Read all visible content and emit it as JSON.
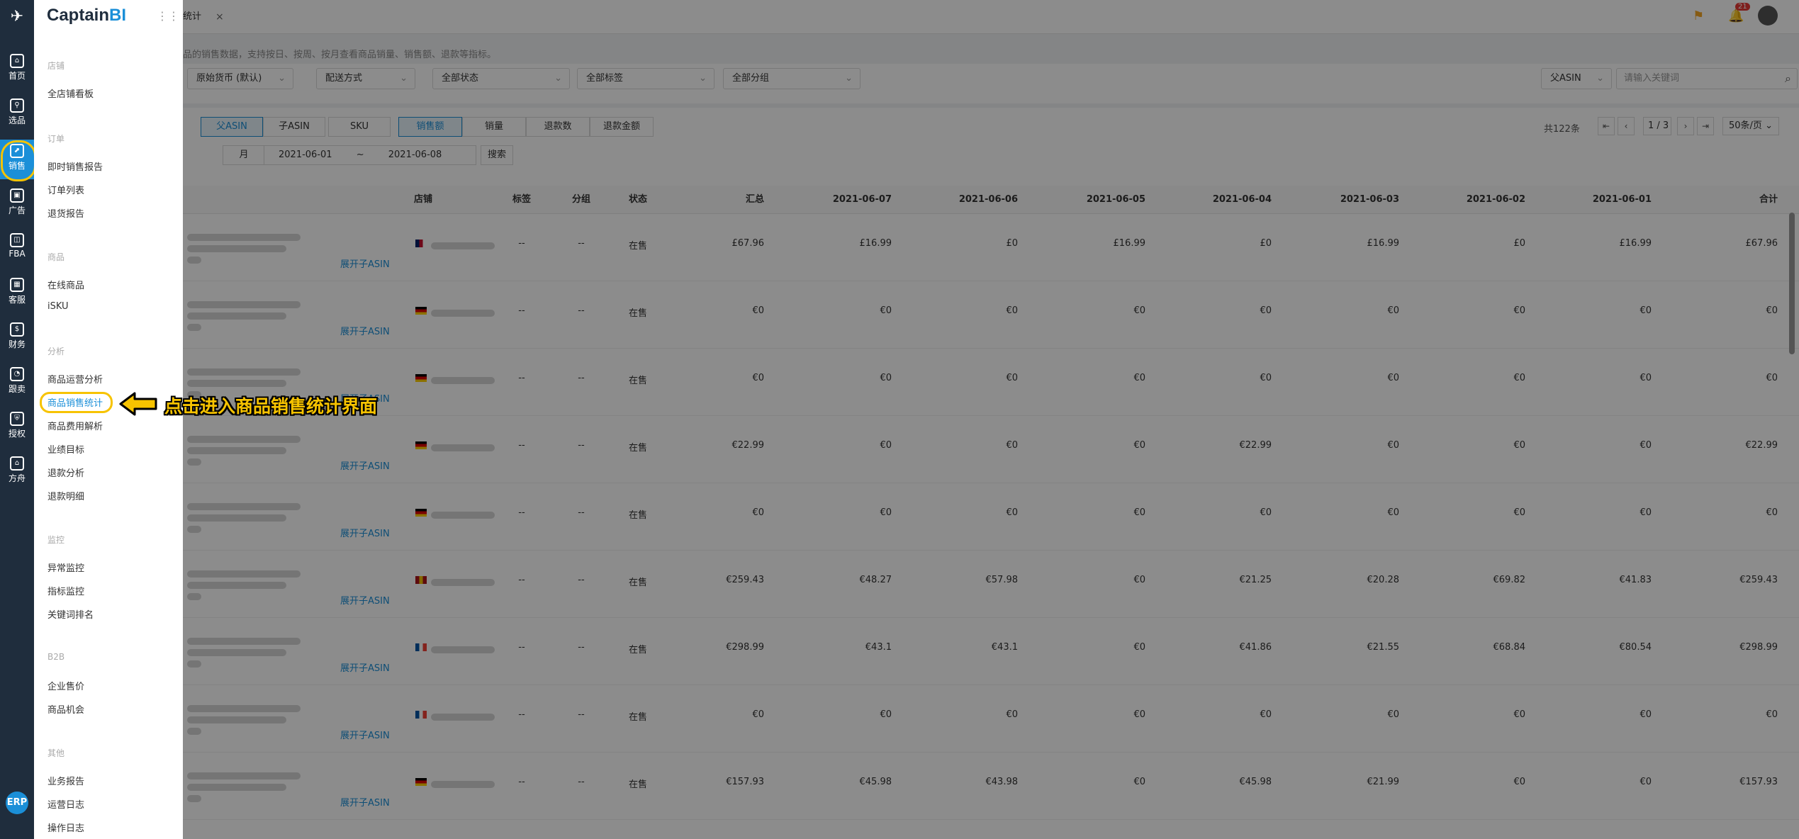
{
  "rail": {
    "items": [
      {
        "label": "首页",
        "icon": "home-icon"
      },
      {
        "label": "选品",
        "icon": "search-icon"
      },
      {
        "label": "销售",
        "icon": "chart-icon"
      },
      {
        "label": "广告",
        "icon": "ad-icon"
      },
      {
        "label": "FBA",
        "icon": "fba-icon"
      },
      {
        "label": "客服",
        "icon": "service-icon"
      },
      {
        "label": "财务",
        "icon": "dollar-icon"
      },
      {
        "label": "跟卖",
        "icon": "pie-icon"
      },
      {
        "label": "授权",
        "icon": "shield-icon"
      },
      {
        "label": "方舟",
        "icon": "ark-icon"
      }
    ],
    "erp": "ERP"
  },
  "brand": {
    "captain": "Captain",
    "bi": "BI"
  },
  "menu": {
    "groups": [
      {
        "title": "店铺",
        "items": [
          "全店铺看板"
        ]
      },
      {
        "title": "订单",
        "items": [
          "即时销售报告",
          "订单列表",
          "退货报告"
        ]
      },
      {
        "title": "商品",
        "items": [
          "在线商品",
          "iSKU"
        ]
      },
      {
        "title": "分析",
        "items": [
          "商品运营分析",
          "商品销售统计",
          "商品费用解析",
          "业绩目标",
          "退款分析",
          "退款明细"
        ]
      },
      {
        "title": "监控",
        "items": [
          "异常监控",
          "指标监控",
          "关键词排名"
        ]
      },
      {
        "title": "B2B",
        "items": [
          "企业售价",
          "商品机会"
        ]
      },
      {
        "title": "其他",
        "items": [
          "业务报告",
          "运营日志",
          "操作日志"
        ]
      }
    ]
  },
  "annotation": "点击进入商品销售统计界面",
  "topbar": {
    "tab_label": "统计",
    "close": "×",
    "badge": "21"
  },
  "description": "品的销售数据，支持按日、按周、按月查看商品销量、销售额、退款等指标。",
  "filters": {
    "currency": "原始货币 (默认)",
    "delivery": "配送方式",
    "status": "全部状态",
    "tags": "全部标签",
    "groups": "全部分组",
    "asin_type": "父ASIN",
    "search_placeholder": "请输入关键词"
  },
  "segments": {
    "asin": [
      "父ASIN",
      "子ASIN",
      "SKU"
    ],
    "metric": [
      "销售额",
      "销量",
      "退款数",
      "退款金额"
    ]
  },
  "pager": {
    "total": "共122条",
    "page": "1",
    "pages": "/ 3",
    "size": "50条/页"
  },
  "dates": {
    "unit": "月",
    "start": "2021-06-01",
    "sep": "~",
    "end": "2021-06-08",
    "search": "搜索"
  },
  "table": {
    "headers": [
      "店铺",
      "标签",
      "分组",
      "状态",
      "汇总",
      "2021-06-07",
      "2021-06-06",
      "2021-06-05",
      "2021-06-04",
      "2021-06-03",
      "2021-06-02",
      "2021-06-01",
      "合计"
    ],
    "expand_label": "展开子ASIN",
    "rows": [
      {
        "flag": "uk",
        "tag": "--",
        "group": "--",
        "status": "在售",
        "values": [
          "£67.96",
          "£16.99",
          "£0",
          "£16.99",
          "£0",
          "£16.99",
          "£0",
          "£16.99",
          "£67.96"
        ]
      },
      {
        "flag": "de",
        "tag": "--",
        "group": "--",
        "status": "在售",
        "values": [
          "€0",
          "€0",
          "€0",
          "€0",
          "€0",
          "€0",
          "€0",
          "€0",
          "€0"
        ]
      },
      {
        "flag": "de",
        "tag": "--",
        "group": "--",
        "status": "在售",
        "values": [
          "€0",
          "€0",
          "€0",
          "€0",
          "€0",
          "€0",
          "€0",
          "€0",
          "€0"
        ]
      },
      {
        "flag": "de",
        "tag": "--",
        "group": "--",
        "status": "在售",
        "values": [
          "€22.99",
          "€0",
          "€0",
          "€0",
          "€22.99",
          "€0",
          "€0",
          "€0",
          "€22.99"
        ]
      },
      {
        "flag": "de",
        "tag": "--",
        "group": "--",
        "status": "在售",
        "values": [
          "€0",
          "€0",
          "€0",
          "€0",
          "€0",
          "€0",
          "€0",
          "€0",
          "€0"
        ]
      },
      {
        "flag": "es",
        "tag": "--",
        "group": "--",
        "status": "在售",
        "values": [
          "€259.43",
          "€48.27",
          "€57.98",
          "€0",
          "€21.25",
          "€20.28",
          "€69.82",
          "€41.83",
          "€259.43"
        ]
      },
      {
        "flag": "fr",
        "tag": "--",
        "group": "--",
        "status": "在售",
        "values": [
          "€298.99",
          "€43.1",
          "€43.1",
          "€0",
          "€41.86",
          "€21.55",
          "€68.84",
          "€80.54",
          "€298.99"
        ]
      },
      {
        "flag": "fr",
        "tag": "--",
        "group": "--",
        "status": "在售",
        "values": [
          "€0",
          "€0",
          "€0",
          "€0",
          "€0",
          "€0",
          "€0",
          "€0",
          "€0"
        ]
      },
      {
        "flag": "de",
        "tag": "--",
        "group": "--",
        "status": "在售",
        "values": [
          "€157.93",
          "€45.98",
          "€43.98",
          "€0",
          "€45.98",
          "€21.99",
          "€0",
          "€0",
          "€157.93"
        ]
      }
    ]
  },
  "colors": {
    "accent": "#1b8fd8",
    "highlight": "#f7c300",
    "rail": "#1f2d3d"
  }
}
